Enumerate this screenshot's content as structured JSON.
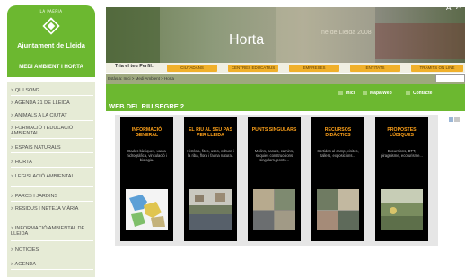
{
  "logo": {
    "town": "LA PAERIA",
    "title": "Ajuntament de Lleida",
    "subtitle": "MEDI AMBIENT I HORTA"
  },
  "banner": {
    "title": "Horta",
    "watermark": "ne de Lleida 2008"
  },
  "profile": {
    "label": "Tria el teu Perfil:",
    "tabs": [
      "CIUTADANS",
      "CENTRES EDUCATIUS",
      "EMPRESES",
      "ENTITATS",
      "TRÀMITS ON LINE"
    ]
  },
  "breadcrumb": "Estàs a: Inici > Medi Ambient > Horta",
  "util": {
    "home": "Inici",
    "sitemap": "Mapa Web",
    "contact": "Contacte",
    "font_small": "A",
    "font_large": "A"
  },
  "section_title": "WEB DEL RIU SEGRE 2",
  "menu": [
    "> QUI SOM?",
    "> AGENDA 21 DE LLEIDA",
    "> ANIMALS A LA CIUTAT",
    "> FORMACIÓ I EDUCACIÓ AMBIENTAL",
    "> ESPAIS NATURALS",
    "> HORTA",
    "> LEGISLACIÓ AMBIENTAL",
    "> PARCS I JARDINS",
    "> RESIDUS I NETEJA VIÀRIA",
    "> INFORMACIÓ AMBIENTAL DE LLEIDA",
    "> NOTÍCIES",
    "> AGENDA"
  ],
  "cards": [
    {
      "title": "INFORMACIÓ GENERAL",
      "desc": "Dades bàsiques, xarxa hidrogràfica, vinculació i biologia."
    },
    {
      "title": "EL RIU AL SEU PAS PER LLEIDA",
      "desc": "Història, fites, usos, cultura i la riba, flora i fauna natural."
    },
    {
      "title": "PUNTS SINGULARS",
      "desc": "Molins, canals, camins, séquies construccions singulars, ponts..."
    },
    {
      "title": "RECURSOS DIDÀCTICS",
      "desc": "Sortides al camp, visites, tallers, exposicions..."
    },
    {
      "title": "PROPOSTES LÚDIQUES",
      "desc": "Excursions, BTT, piragüisme, ecoturisme..."
    }
  ],
  "colors": {
    "green": "#6cb830",
    "orange": "#ffa21a",
    "tab": "#f0b02b",
    "menu_bg": "#e6ebd6"
  }
}
